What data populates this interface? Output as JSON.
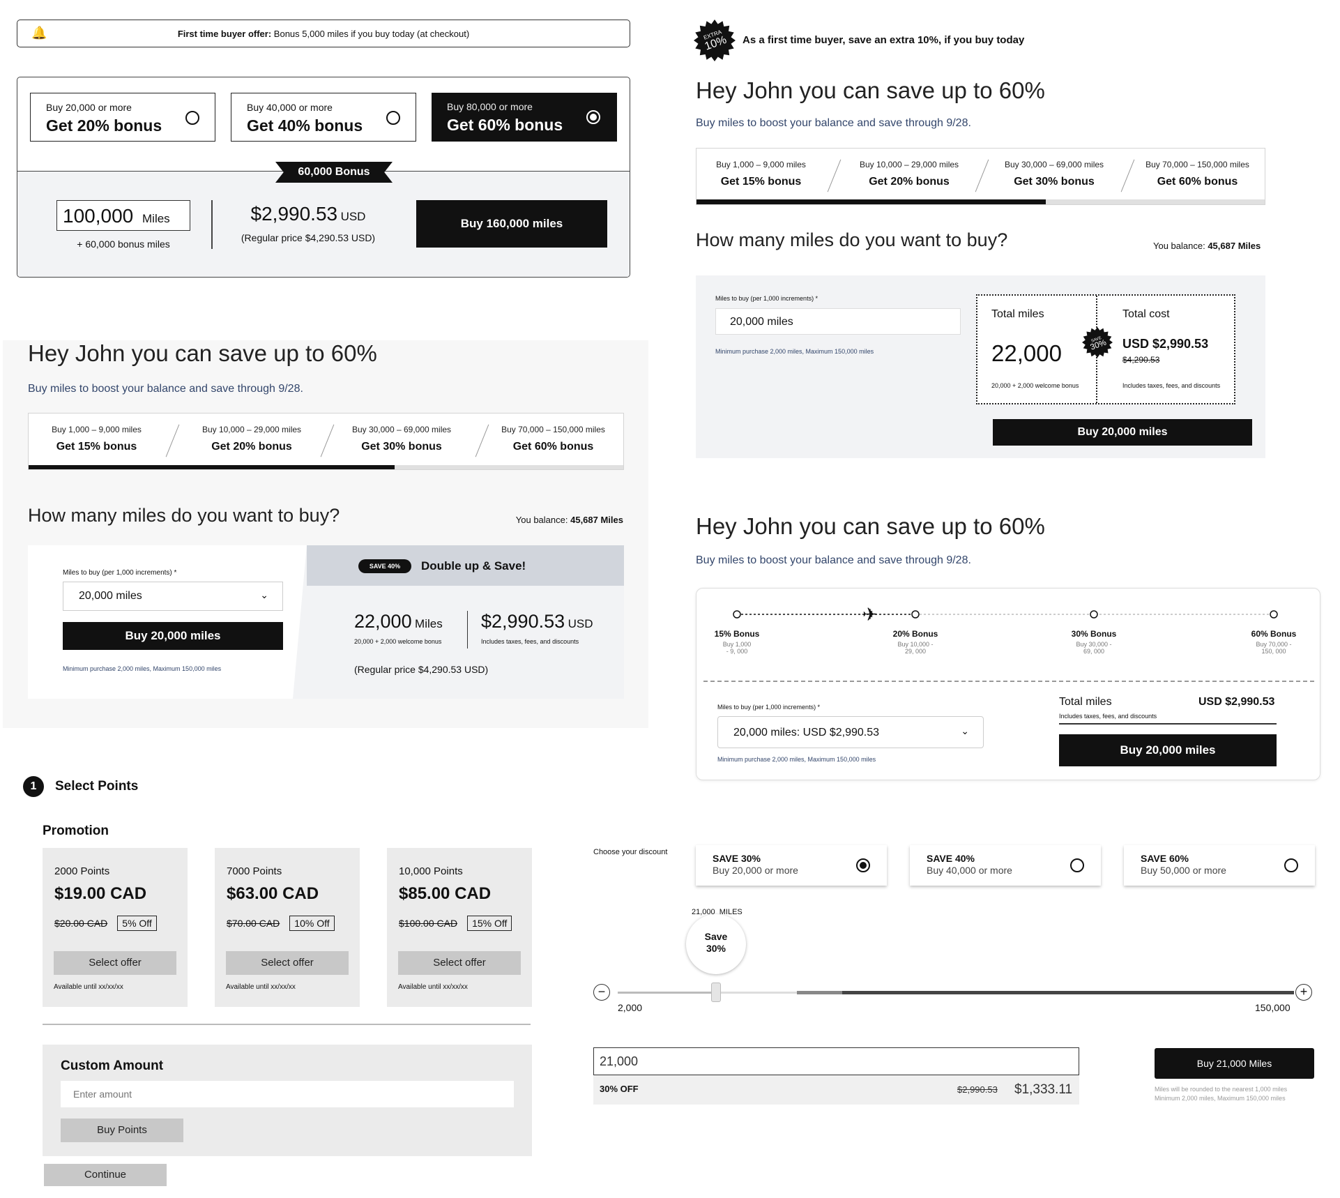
{
  "panel_a": {
    "offer_banner": {
      "bold": "First time buyer offer:",
      "text": "Bonus 5,000 miles if you buy today (at checkout)"
    },
    "options": [
      {
        "small": "Buy 20,000 or more",
        "big": "Get 20% bonus",
        "selected": false
      },
      {
        "small": "Buy 40,000 or more",
        "big": "Get 40% bonus",
        "selected": false
      },
      {
        "small": "Buy 80,000 or more",
        "big": "Get 60% bonus",
        "selected": true
      }
    ],
    "bonus_tag": "60,000 Bonus",
    "miles_value": "100,000",
    "miles_unit": "Miles",
    "bonus_miles": "+ 60,000 bonus miles",
    "price": "$2,990.53",
    "currency": "USD",
    "regular_price": "(Regular price $4,290.53 USD)",
    "buy_button": "Buy 160,000 miles"
  },
  "panel_b": {
    "title": "Hey John you can save up to 60%",
    "subtitle": "Buy miles to boost your balance and save through 9/28.",
    "tiers": [
      {
        "range": "Buy 1,000 – 9,000 miles",
        "bonus": "Get 15% bonus"
      },
      {
        "range": "Buy 10,000 – 29,000 miles",
        "bonus": "Get 20% bonus"
      },
      {
        "range": "Buy 30,000 – 69,000 miles",
        "bonus": "Get 30% bonus"
      },
      {
        "range": "Buy 70,000 – 150,000 miles",
        "bonus": "Get 60% bonus"
      }
    ],
    "progress_fraction": 0.615,
    "question": "How many miles do you want to buy?",
    "balance_label": "You balance:",
    "balance_value": "45,687 Miles",
    "field_label": "Miles to buy (per 1,000 increments) *",
    "field_value": "20,000 miles",
    "buy_button": "Buy 20,000 miles",
    "min_max": "Minimum purchase 2,000 miles, Maximum 150,000 miles",
    "save_badge": "SAVE 40%",
    "double_up": "Double up & Save!",
    "total_miles": "22,000",
    "miles_unit": "Miles",
    "miles_breakdown": "20,000 + 2,000 welcome bonus",
    "price": "$2,990.53",
    "currency": "USD",
    "price_note": "Includes taxes, fees, and discounts",
    "regular_price": "(Regular price $4,290.53 USD)"
  },
  "panel_c": {
    "step_number": "1",
    "step_title": "Select Points",
    "promotion_title": "Promotion",
    "offers": [
      {
        "points": "2000 Points",
        "price": "$19.00 CAD",
        "was": "$20.00 CAD",
        "off": "5% Off",
        "button": "Select offer",
        "avail": "Available until xx/xx/xx"
      },
      {
        "points": "7000 Points",
        "price": "$63.00 CAD",
        "was": "$70.00 CAD",
        "off": "10% Off",
        "button": "Select offer",
        "avail": "Available until xx/xx/xx"
      },
      {
        "points": "10,000 Points",
        "price": "$85.00 CAD",
        "was": "$100.00 CAD",
        "off": "15% Off",
        "button": "Select offer",
        "avail": "Available until xx/xx/xx"
      }
    ],
    "custom_title": "Custom Amount",
    "custom_placeholder": "Enter amount",
    "buy_points": "Buy Points",
    "continue": "Continue"
  },
  "panel_d": {
    "extra_badge_top": "EXTRA",
    "extra_badge_pct": "10%",
    "headline": "As a first time buyer, save an extra 10%, if you buy today",
    "title": "Hey John you can save up to 60%",
    "subtitle": "Buy miles to boost your balance and save through 9/28.",
    "tiers": [
      {
        "range": "Buy 1,000 – 9,000 miles",
        "bonus": "Get 15% bonus"
      },
      {
        "range": "Buy 10,000 – 29,000 miles",
        "bonus": "Get 20% bonus"
      },
      {
        "range": "Buy 30,000 – 69,000 miles",
        "bonus": "Get 30% bonus"
      },
      {
        "range": "Buy 70,000 – 150,000 miles",
        "bonus": "Get 60% bonus"
      }
    ],
    "progress_fraction": 0.615,
    "question": "How many miles do you want to buy?",
    "balance_label": "You balance:",
    "balance_value": "45,687 Miles",
    "field_label": "Miles to buy (per 1,000 increments) *",
    "field_value": "20,000 miles",
    "min_max": "Minimum purchase 2,000 miles, Maximum 150,000 miles",
    "total_miles_label": "Total miles",
    "total_miles": "22,000",
    "miles_breakdown": "20,000 + 2,000 welcome bonus",
    "save_badge_top": "SAVE",
    "save_badge_pct": "30%",
    "total_cost_label": "Total cost",
    "total_cost": "USD $2,990.53",
    "was_cost": "$4,290.53",
    "cost_note": "Includes taxes, fees, and discounts",
    "buy_button": "Buy 20,000 miles"
  },
  "panel_e": {
    "title": "Hey John you can save up to 60%",
    "subtitle": "Buy miles to boost your balance and save through 9/28.",
    "steps": [
      {
        "bonus": "15% Bonus",
        "range": "Buy 1,000 - 9, 000"
      },
      {
        "bonus": "20% Bonus",
        "range": "Buy 10,000 - 29, 000"
      },
      {
        "bonus": "30% Bonus",
        "range": "Buy 30,000 - 69, 000"
      },
      {
        "bonus": "60% Bonus",
        "range": "Buy 70,000 - 150, 000"
      }
    ],
    "field_label": "Miles to buy (per 1,000 increments) *",
    "select_value": "20,000 miles: USD $2,990.53",
    "min_max": "Minimum purchase 2,000 miles, Maximum 150,000 miles",
    "total_label": "Total miles",
    "total_value": "USD $2,990.53",
    "total_note": "Includes taxes, fees, and discounts",
    "buy_button": "Buy 20,000 miles"
  },
  "panel_f": {
    "choose_label": "Choose your discount",
    "discounts": [
      {
        "title": "SAVE 30%",
        "desc": "Buy 20,000 or more",
        "selected": true
      },
      {
        "title": "SAVE 40%",
        "desc": "Buy 40,000 or more",
        "selected": false
      },
      {
        "title": "SAVE 60%",
        "desc": "Buy 50,000 or more",
        "selected": false
      }
    ],
    "slider_miles": "21,000  MILES",
    "bubble_line1": "Save",
    "bubble_line2": "30%",
    "slider_min": "2,000",
    "slider_max": "150,000",
    "slider_value_fraction": 0.13,
    "input_value": "21,000",
    "off_label": "30% OFF",
    "was_price": "$2,990.53",
    "price": "$1,333.11",
    "buy_button": "Buy 21,000 Miles",
    "note1": "Miles will be rounded to the nearest 1,000 miles",
    "note2": "Minimum 2,000 miles, Maximum 150,000 miles"
  }
}
